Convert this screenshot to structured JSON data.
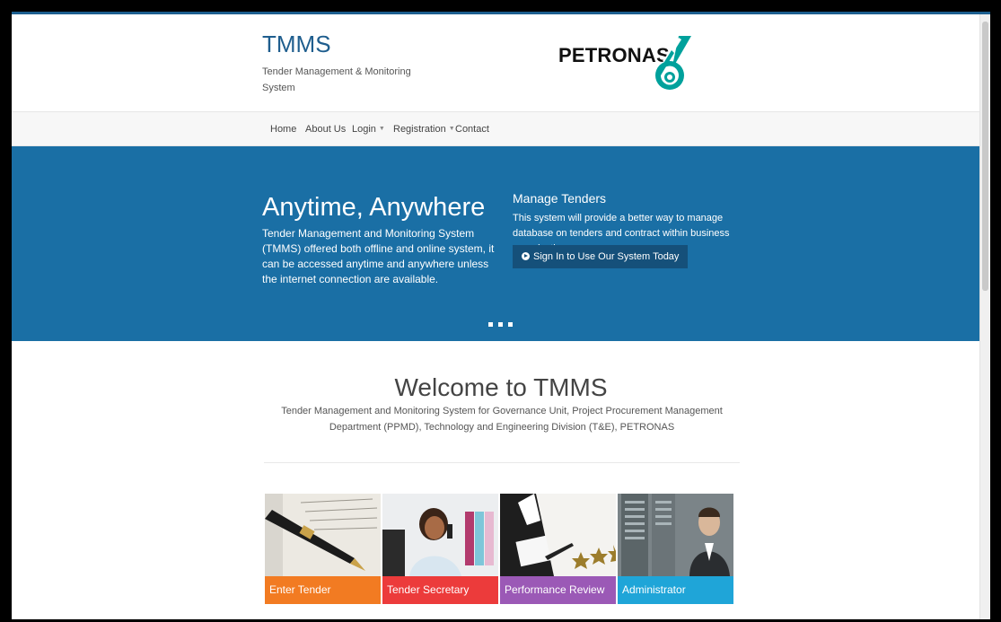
{
  "header": {
    "title": "TMMS",
    "subtitle": "Tender Management & Monitoring System",
    "logo_text": "PETRONAS"
  },
  "nav": {
    "items": [
      {
        "label": "Home"
      },
      {
        "label": "About Us"
      },
      {
        "label": "Login"
      },
      {
        "label": "Registration"
      },
      {
        "label": "Contact"
      }
    ]
  },
  "hero": {
    "title": "Anytime, Anywhere",
    "text": "Tender Management and Monitoring System (TMMS) offered both offline and online system, it can be accessed anytime and anywhere unless the internet connection are available.",
    "manage_title": "Manage Tenders",
    "manage_text": "This system will provide a better way to manage database on tenders and contract within business organization.",
    "button_label": "Sign In to Use Our System Today"
  },
  "welcome": {
    "title": "Welcome to TMMS",
    "text": "Tender Management and Monitoring System for Governance Unit, Project Procurement Management Department (PPMD), Technology and Engineering Division (T&E), PETRONAS"
  },
  "cards": [
    {
      "label": "Enter Tender",
      "color": "#f27b22"
    },
    {
      "label": "Tender Secretary",
      "color": "#ec3b3b"
    },
    {
      "label": "Performance Review",
      "color": "#9b59b6"
    },
    {
      "label": "Administrator",
      "color": "#1fa5d8"
    }
  ],
  "colors": {
    "hero_bg": "#1a6fa5",
    "brand": "#1f5e8e",
    "logo_teal": "#00a19c"
  }
}
